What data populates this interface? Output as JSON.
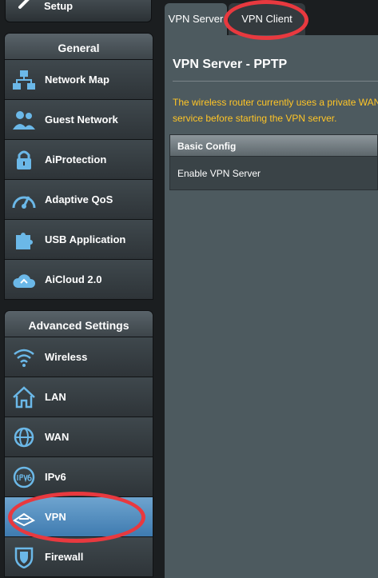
{
  "sidebar": {
    "setup_label": "Setup",
    "general": {
      "header": "General",
      "items": [
        {
          "label": "Network Map",
          "icon": "network-map-icon"
        },
        {
          "label": "Guest Network",
          "icon": "guest-network-icon"
        },
        {
          "label": "AiProtection",
          "icon": "lock-icon"
        },
        {
          "label": "Adaptive QoS",
          "icon": "speedometer-icon"
        },
        {
          "label": "USB Application",
          "icon": "puzzle-icon"
        },
        {
          "label": "AiCloud 2.0",
          "icon": "cloud-icon"
        }
      ]
    },
    "advanced": {
      "header": "Advanced Settings",
      "items": [
        {
          "label": "Wireless",
          "icon": "wifi-icon"
        },
        {
          "label": "LAN",
          "icon": "home-icon"
        },
        {
          "label": "WAN",
          "icon": "globe-icon"
        },
        {
          "label": "IPv6",
          "icon": "ipv6-globe-icon"
        },
        {
          "label": "VPN",
          "icon": "vpn-icon",
          "active": true
        },
        {
          "label": "Firewall",
          "icon": "shield-icon"
        }
      ]
    }
  },
  "main": {
    "tabs": [
      {
        "label": "VPN Server",
        "active": true
      },
      {
        "label": "VPN Client"
      }
    ],
    "page_title": "VPN Server - PPTP",
    "description_line1": "The wireless router currently uses a private WAN IP address. Please make sure to set up",
    "description_line2": "service before starting the VPN server.",
    "basic_config_header": "Basic Config",
    "enable_vpn_server_label": "Enable VPN Server"
  },
  "colors": {
    "accent_active": "#5a93c3",
    "warning_text": "#ffc526",
    "annotation": "#e8393f",
    "icon_blue": "#6bb8e8"
  }
}
